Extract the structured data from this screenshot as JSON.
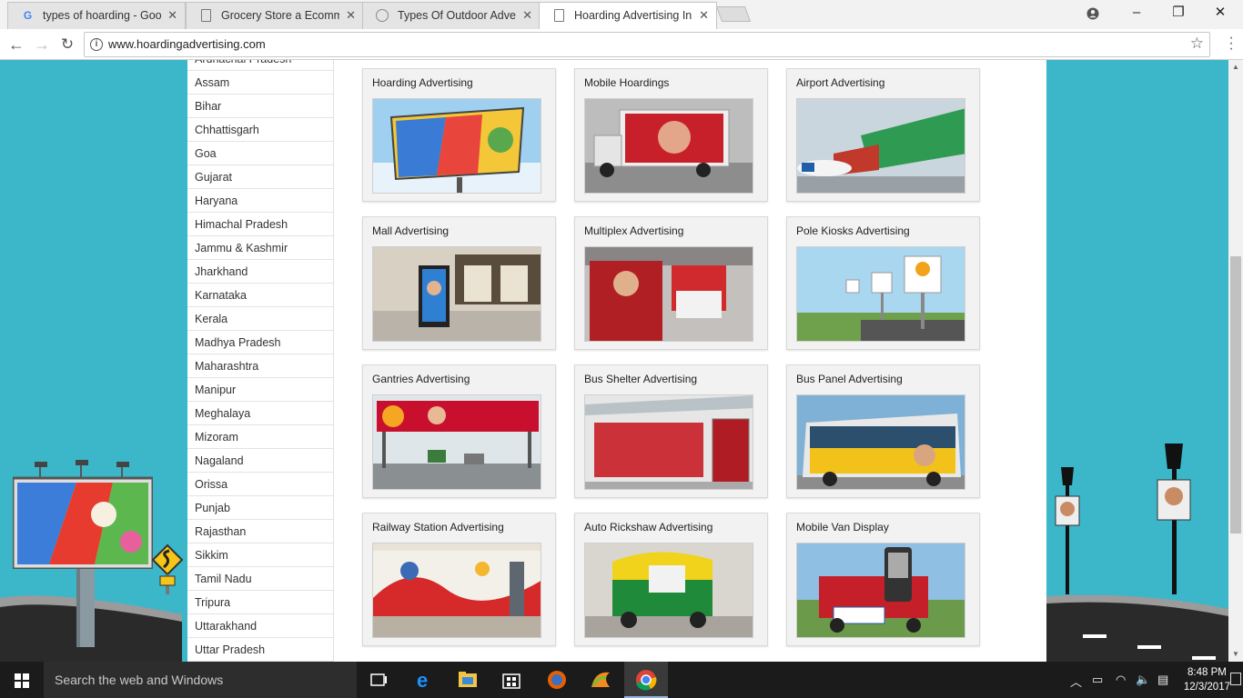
{
  "browser": {
    "tabs": [
      {
        "title": "types of hoarding - Goog",
        "icon": "google-icon"
      },
      {
        "title": "Grocery Store a Ecomme",
        "icon": "document-icon"
      },
      {
        "title": "Types Of Outdoor Advert",
        "icon": "globe-icon"
      },
      {
        "title": "Hoarding Advertising In",
        "icon": "document-icon"
      }
    ],
    "url": "www.hoardingadvertising.com"
  },
  "sidebar": {
    "states": [
      "Arunachal Pradesh",
      "Assam",
      "Bihar",
      "Chhattisgarh",
      "Goa",
      "Gujarat",
      "Haryana",
      "Himachal Pradesh",
      "Jammu & Kashmir",
      "Jharkhand",
      "Karnataka",
      "Kerala",
      "Madhya Pradesh",
      "Maharashtra",
      "Manipur",
      "Meghalaya",
      "Mizoram",
      "Nagaland",
      "Orissa",
      "Punjab",
      "Rajasthan",
      "Sikkim",
      "Tamil Nadu",
      "Tripura",
      "Uttarakhand",
      "Uttar Pradesh"
    ]
  },
  "cards": [
    {
      "title": "Hoarding Advertising"
    },
    {
      "title": "Mobile Hoardings"
    },
    {
      "title": "Airport Advertising"
    },
    {
      "title": "Mall Advertising"
    },
    {
      "title": "Multiplex Advertising"
    },
    {
      "title": "Pole Kiosks Advertising"
    },
    {
      "title": "Gantries Advertising"
    },
    {
      "title": "Bus Shelter Advertising"
    },
    {
      "title": "Bus Panel Advertising"
    },
    {
      "title": "Railway Station Advertising"
    },
    {
      "title": "Auto Rickshaw Advertising"
    },
    {
      "title": "Mobile Van Display"
    }
  ],
  "taskbar": {
    "search_placeholder": "Search the web and Windows",
    "time": "8:48 PM",
    "date": "12/3/2017"
  },
  "colors": {
    "page_background": "#3bb7c9",
    "taskbar": "#1b1b1b"
  }
}
